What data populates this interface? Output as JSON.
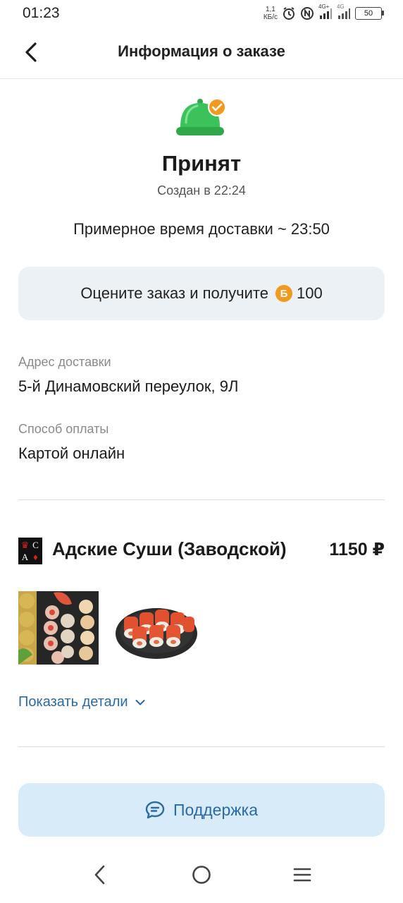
{
  "status_bar": {
    "time": "01:23",
    "speed_value": "1,1",
    "speed_unit": "КБ/с",
    "network_1": "4G+",
    "network_2": "4G",
    "battery": "50"
  },
  "header": {
    "title": "Информация о заказе"
  },
  "order": {
    "status": "Принят",
    "created": "Создан в 22:24",
    "delivery_estimate": "Примерное время доставки ~ 23:50",
    "rate_prompt": "Оцените заказ и получите",
    "bonus_symbol": "Б",
    "bonus_amount": "100"
  },
  "delivery": {
    "address_label": "Адрес доставки",
    "address_value": "5-й Динамовский переулок, 9Л",
    "payment_label": "Способ оплаты",
    "payment_value": "Картой онлайн"
  },
  "restaurant": {
    "name": "Адские Суши (Заводской)",
    "price": "1150 ₽",
    "show_details": "Показать детали"
  },
  "support": {
    "label": "Поддержка"
  },
  "colors": {
    "accent_blue": "#2b6aa6",
    "illustration_green": "#3cc25a",
    "badge_orange": "#f29a1e",
    "card_bg": "#ecf1f5",
    "support_bg": "#d8ebf8"
  }
}
